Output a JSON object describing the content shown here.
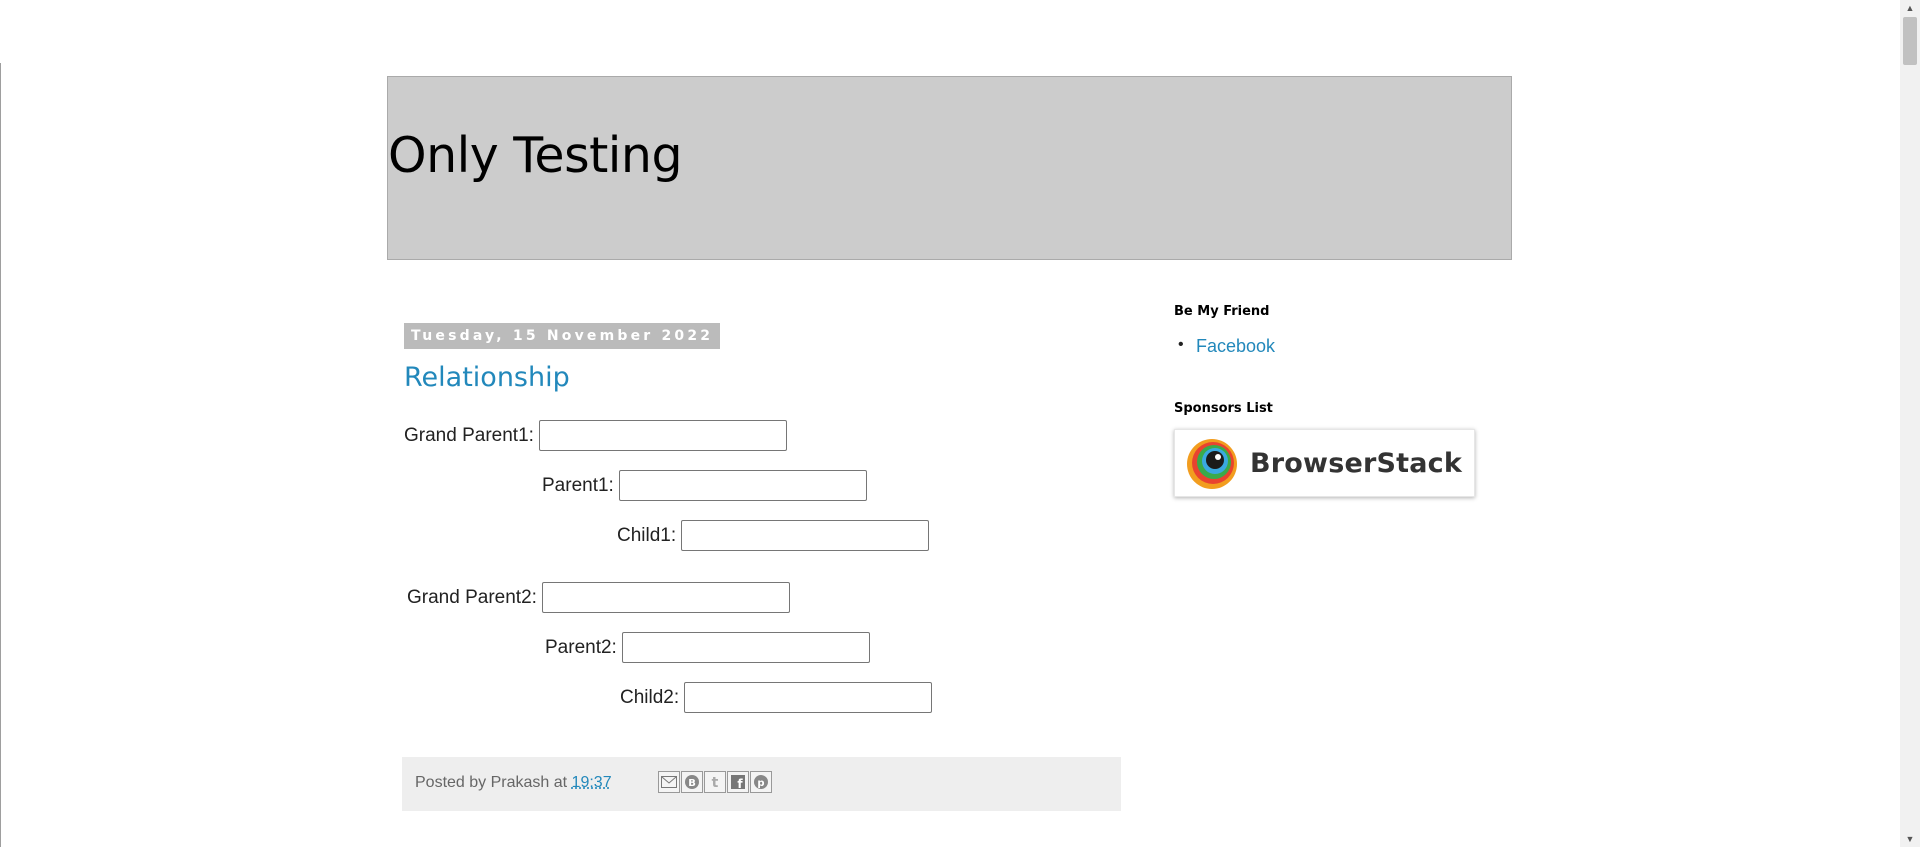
{
  "blog": {
    "title": "Only Testing"
  },
  "post": {
    "date": "Tuesday, 15 November 2022",
    "title": "Relationship",
    "fields": [
      {
        "label": "Grand Parent1:",
        "value": ""
      },
      {
        "label": "Parent1:",
        "value": ""
      },
      {
        "label": "Child1:",
        "value": ""
      },
      {
        "label": "Grand Parent2:",
        "value": ""
      },
      {
        "label": "Parent2:",
        "value": ""
      },
      {
        "label": "Child2:",
        "value": ""
      }
    ],
    "footer": {
      "posted_by": "Posted by Prakash at",
      "time": "19:37",
      "share": [
        "email-icon",
        "blogger-icon",
        "twitter-icon",
        "facebook-icon",
        "pinterest-icon"
      ]
    }
  },
  "sidebar": {
    "friend_heading": "Be My Friend",
    "friend_links": [
      "Facebook"
    ],
    "sponsors_heading": "Sponsors List",
    "sponsor_name": "BrowserStack"
  },
  "colors": {
    "link": "#2288bb",
    "header_bg": "#cccccc",
    "date_bg": "#bbbbbb",
    "footer_bg": "#eeeeee"
  }
}
